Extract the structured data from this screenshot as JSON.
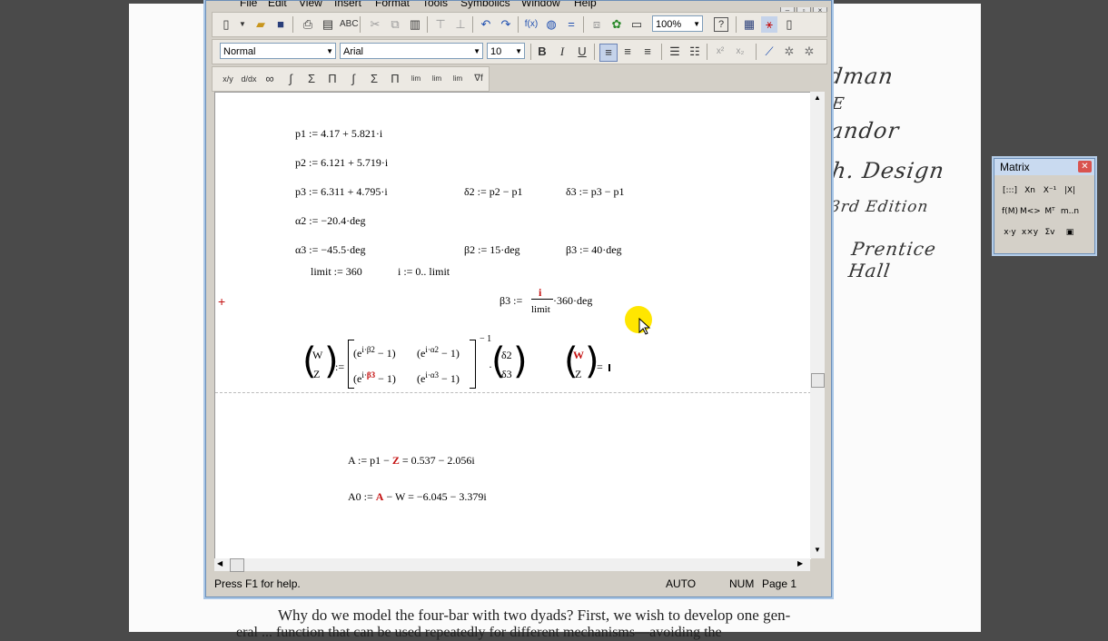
{
  "menu": [
    "File",
    "Edit",
    "View",
    "Insert",
    "Format",
    "Tools",
    "Symbolics",
    "Window",
    "Help"
  ],
  "toolbar": {
    "zoom": "100%",
    "style": "Normal",
    "font": "Arial",
    "size": "10"
  },
  "math_palette_icons": [
    "x/y",
    "d/dx",
    "∞",
    "∫",
    "Σ",
    "Π",
    "Σ",
    "Π",
    "lim",
    "lim",
    "lim",
    "∇f"
  ],
  "worksheet": {
    "p1": "p1 := 4.17 + 5.821·i",
    "p2": "p2 := 6.121 + 5.719·i",
    "p3": "p3 := 6.311 + 4.795·i",
    "d2": "δ2 := p2 − p1",
    "d3": "δ3 := p3 − p1",
    "a2": "α2 := −20.4·deg",
    "a3": "α3 := −45.5·deg",
    "b2": "β2 := 15·deg",
    "b3": "β3 := 40·deg",
    "limit": "limit := 360",
    "irange": "i := 0.. limit",
    "beta3_lhs": "β3 :=",
    "beta3_num": "i",
    "beta3_den": "limit",
    "beta3_rhs": "·360·deg",
    "A": {
      "pre": "A := p1 − ",
      "red": "Z",
      "post": " = 0.537 − 2.056i"
    },
    "A0": {
      "pre": "A0 := ",
      "red": "A",
      "post": " − W = −6.045 − 3.379i"
    }
  },
  "status": {
    "help": "Press F1 for help.",
    "mode": "AUTO",
    "num": "NUM",
    "page": "Page 1"
  },
  "matrix_palette": {
    "title": "Matrix",
    "items": [
      "[:::]",
      "Xn",
      "X⁻¹",
      "|X|",
      "f(M)",
      "M<>",
      "Mᵀ",
      "m..n",
      "x·y",
      "x×y",
      "Σv",
      "▣"
    ]
  },
  "background": {
    "handwriting": [
      "dman",
      "E",
      "andor",
      "h. Design",
      "3rd Edition",
      "Prentice Hall"
    ],
    "book_line1": "Why do we model the four-bar with two dyads? First, we wish to develop one gen-",
    "book_line2": "eral ... function that can be used repeatedly for different mechanisms—avoiding the"
  }
}
